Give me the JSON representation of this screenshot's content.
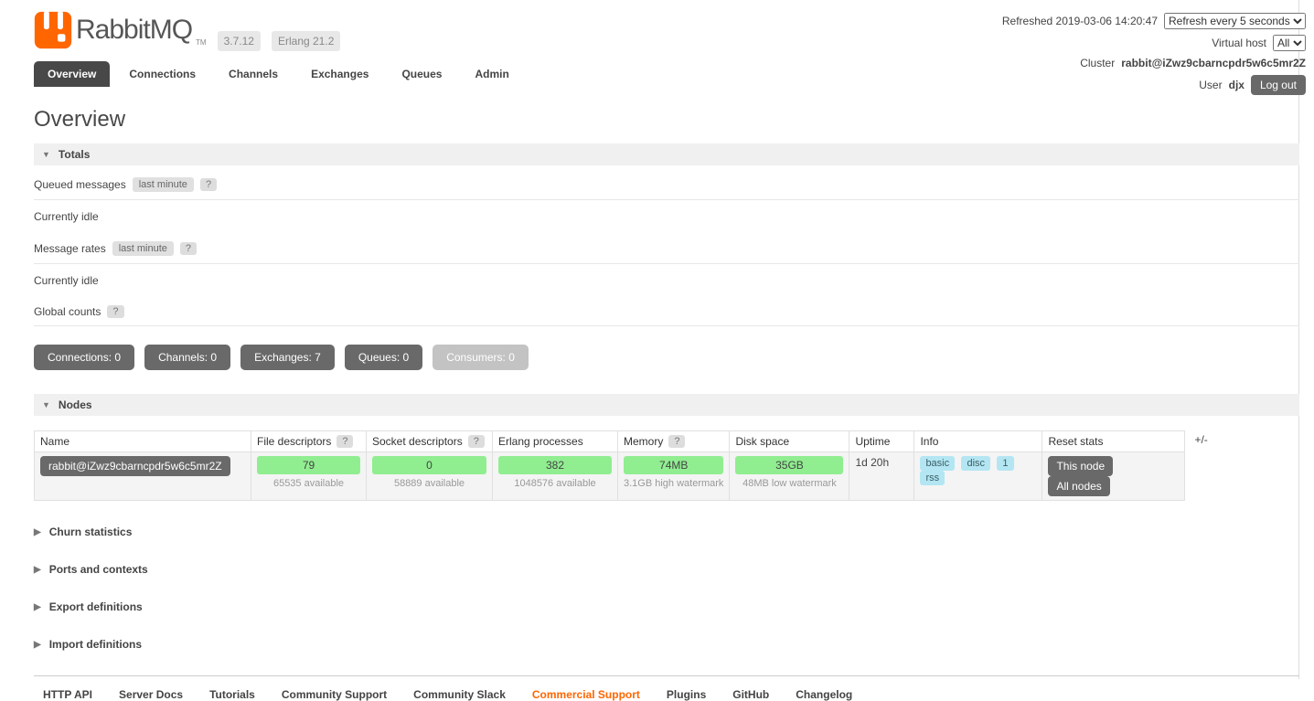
{
  "header": {
    "logo": {
      "brand": "RabbitMQ",
      "tm": "TM",
      "version_badge": "3.7.12",
      "erlang_badge": "Erlang 21.2"
    },
    "refresh": {
      "label": "Refreshed 2019-03-06 14:20:47",
      "selected": "Refresh every 5 seconds"
    },
    "vhost": {
      "label": "Virtual host",
      "selected": "All"
    },
    "cluster": {
      "label": "Cluster",
      "value": "rabbit@iZwz9cbarncpdr5w6c5mr2Z"
    },
    "user": {
      "label": "User",
      "value": "djx",
      "logout_label": "Log out"
    }
  },
  "tabs": [
    {
      "label": "Overview",
      "active": true
    },
    {
      "label": "Connections",
      "active": false
    },
    {
      "label": "Channels",
      "active": false
    },
    {
      "label": "Exchanges",
      "active": false
    },
    {
      "label": "Queues",
      "active": false
    },
    {
      "label": "Admin",
      "active": false
    }
  ],
  "page": {
    "title": "Overview"
  },
  "icons": {
    "collapse": "▼",
    "expand": "▶"
  },
  "totals": {
    "section_title": "Totals",
    "queued_messages": {
      "label": "Queued messages",
      "badge": "last minute",
      "help": "?",
      "status": "Currently idle"
    },
    "message_rates": {
      "label": "Message rates",
      "badge": "last minute",
      "help": "?",
      "status": "Currently idle"
    },
    "global_counts": {
      "label": "Global counts",
      "help": "?"
    },
    "count_buttons": [
      {
        "label": "Connections: 0",
        "enabled": true
      },
      {
        "label": "Channels: 0",
        "enabled": true
      },
      {
        "label": "Exchanges: 7",
        "enabled": true
      },
      {
        "label": "Queues: 0",
        "enabled": true
      },
      {
        "label": "Consumers: 0",
        "enabled": false
      }
    ]
  },
  "nodes": {
    "section_title": "Nodes",
    "columns": [
      {
        "label": "Name"
      },
      {
        "label": "File descriptors",
        "help": "?"
      },
      {
        "label": "Socket descriptors",
        "help": "?"
      },
      {
        "label": "Erlang processes"
      },
      {
        "label": "Memory",
        "help": "?"
      },
      {
        "label": "Disk space"
      },
      {
        "label": "Uptime"
      },
      {
        "label": "Info"
      },
      {
        "label": "Reset stats"
      }
    ],
    "row": {
      "name": "rabbit@iZwz9cbarncpdr5w6c5mr2Z",
      "file_descriptors": {
        "used": "79",
        "available": "65535 available"
      },
      "socket_descriptors": {
        "used": "0",
        "available": "58889 available"
      },
      "erlang_processes": {
        "used": "382",
        "available": "1048576 available"
      },
      "memory": {
        "used": "74MB",
        "detail": "3.1GB high watermark"
      },
      "disk_space": {
        "used": "35GB",
        "detail": "48MB low watermark"
      },
      "uptime": "1d 20h",
      "info_badges": [
        "basic",
        "disc",
        "1",
        "rss"
      ],
      "reset_buttons": [
        "This node",
        "All nodes"
      ]
    },
    "plus_minus": "+/-"
  },
  "collapsed_sections": [
    {
      "label": "Churn statistics"
    },
    {
      "label": "Ports and contexts"
    },
    {
      "label": "Export definitions"
    },
    {
      "label": "Import definitions"
    }
  ],
  "footer": {
    "links": [
      {
        "label": "HTTP API",
        "highlight": false
      },
      {
        "label": "Server Docs",
        "highlight": false
      },
      {
        "label": "Tutorials",
        "highlight": false
      },
      {
        "label": "Community Support",
        "highlight": false
      },
      {
        "label": "Community Slack",
        "highlight": false
      },
      {
        "label": "Commercial Support",
        "highlight": true
      },
      {
        "label": "Plugins",
        "highlight": false
      },
      {
        "label": "GitHub",
        "highlight": false
      },
      {
        "label": "Changelog",
        "highlight": false
      }
    ]
  },
  "colors": {
    "accent_orange": "#ff6600",
    "green_bar": "#90ee90",
    "dark_button": "#696969",
    "info_badge_blue": "#b3e6f2"
  }
}
